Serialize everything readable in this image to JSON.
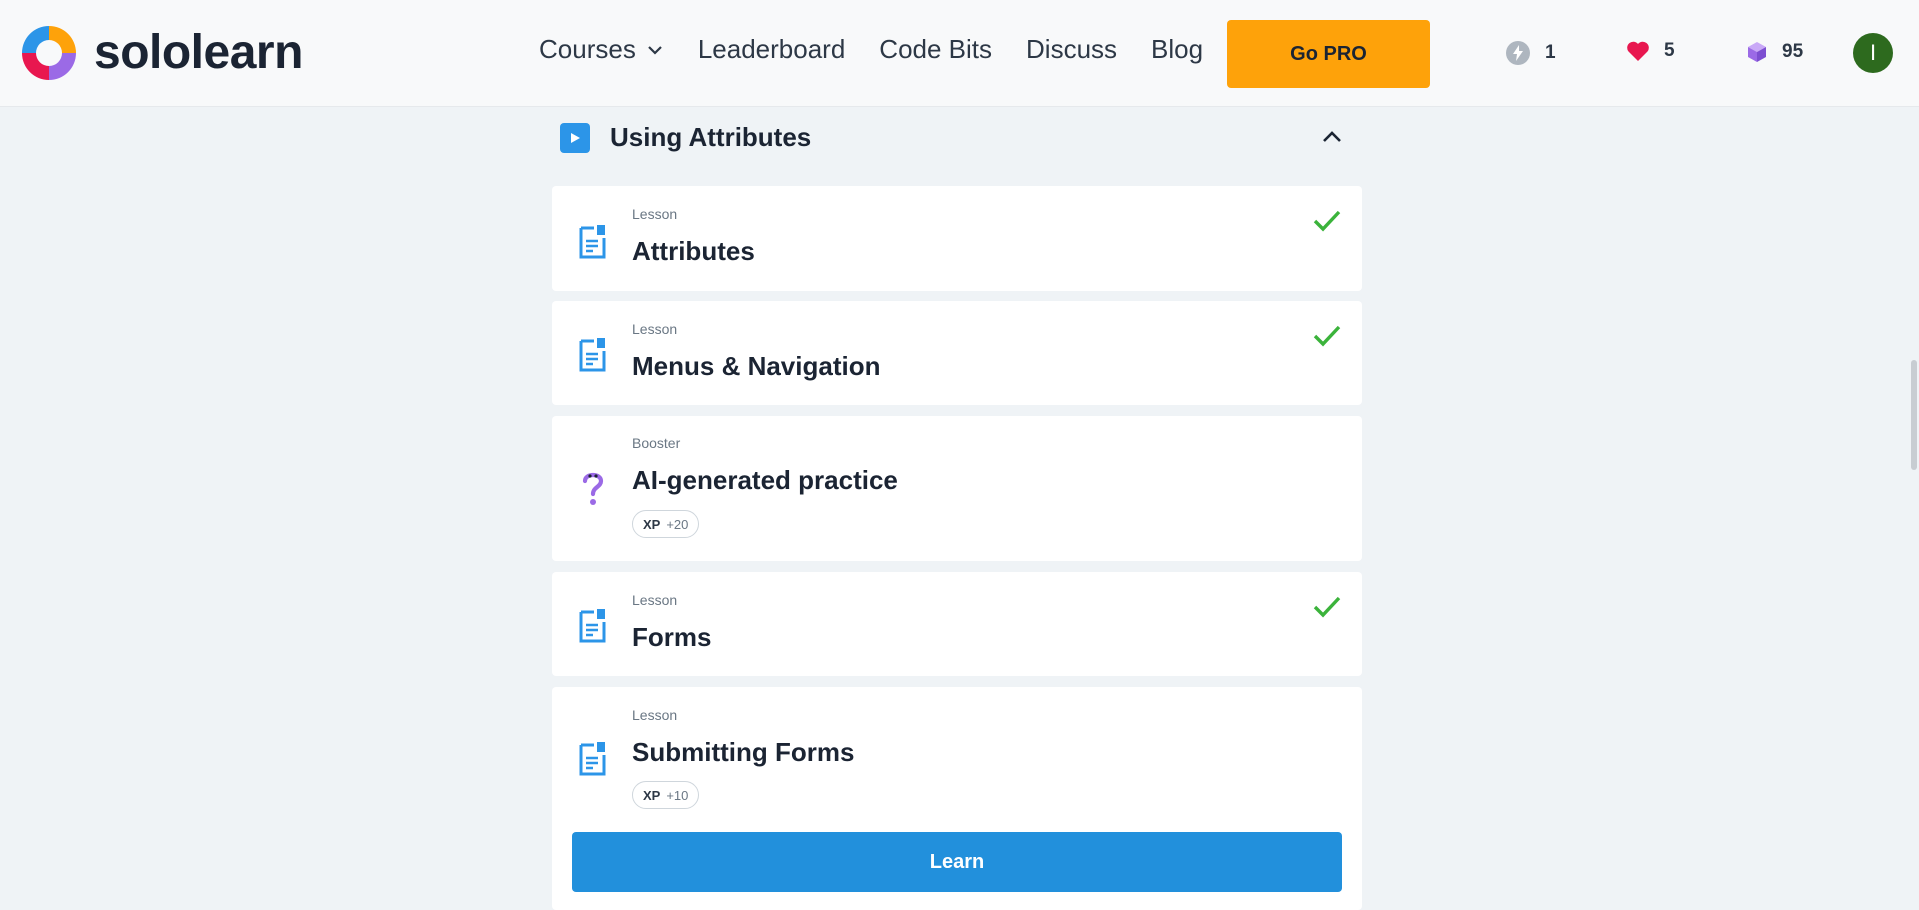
{
  "brand": {
    "name": "sololearn"
  },
  "nav": {
    "items": [
      {
        "label": "Courses",
        "has_dropdown": true
      },
      {
        "label": "Leaderboard"
      },
      {
        "label": "Code Bits"
      },
      {
        "label": "Discuss"
      },
      {
        "label": "Blog"
      }
    ],
    "gopro_label": "Go PRO"
  },
  "stats": {
    "streak": "1",
    "hearts": "5",
    "gems": "95"
  },
  "user": {
    "avatar_initial": "I"
  },
  "section": {
    "title": "Using Attributes",
    "expanded": true
  },
  "items": [
    {
      "type": "Lesson",
      "title": "Attributes",
      "completed": true
    },
    {
      "type": "Lesson",
      "title": "Menus & Navigation",
      "completed": true
    },
    {
      "type": "Booster",
      "title": "AI-generated practice",
      "completed": false,
      "xp_label": "XP",
      "xp_value": "+20"
    },
    {
      "type": "Lesson",
      "title": "Forms",
      "completed": true
    },
    {
      "type": "Lesson",
      "title": "Submitting Forms",
      "completed": false,
      "xp_label": "XP",
      "xp_value": "+10"
    }
  ],
  "learn_button_label": "Learn",
  "colors": {
    "accent_blue": "#2290dc",
    "pro_orange": "#fea20a",
    "check_green": "#3bb33b",
    "heart_red": "#e8174f",
    "gem_purple": "#9b6ae6",
    "avatar_green": "#2d6a1e"
  }
}
